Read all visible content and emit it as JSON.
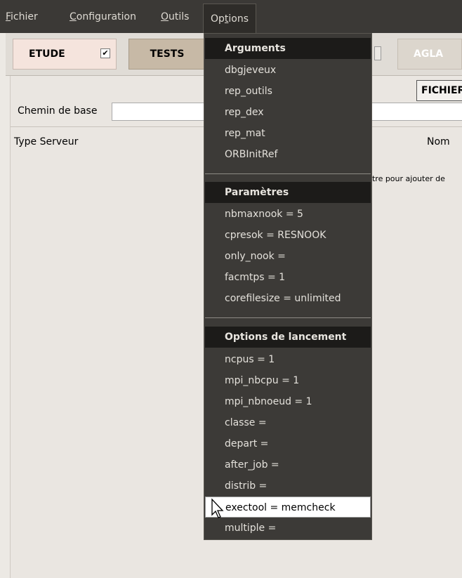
{
  "menubar": {
    "items": [
      {
        "label": "Fichier",
        "underline": "F",
        "rest": "ichier"
      },
      {
        "label": "Configuration",
        "underline": "C",
        "rest": "onfiguration"
      },
      {
        "label": "Outils",
        "underline": "O",
        "rest": "utils"
      },
      {
        "label": "Options",
        "pre": "Op",
        "underline": "t",
        "rest": "ions"
      }
    ]
  },
  "toolbar": {
    "etude_label": "ETUDE",
    "etude_checked": "✔",
    "tests_label": "TESTS",
    "agla_label": "AGLA"
  },
  "main": {
    "fichier_button": "FICHIER",
    "chemin_label": "Chemin de base",
    "chemin_value": "",
    "type_serveur_label": "Type Serveur",
    "nom_label": "Nom",
    "hint_text": "ntre pour ajouter de"
  },
  "options_menu": {
    "sections": [
      {
        "header": "Arguments",
        "items": [
          "dbgjeveux",
          "rep_outils",
          "rep_dex",
          "rep_mat",
          "ORBInitRef"
        ]
      },
      {
        "header": "Paramètres",
        "items": [
          "nbmaxnook = 5",
          "cpresok = RESNOOK",
          "only_nook =",
          "facmtps = 1",
          "corefilesize = unlimited"
        ]
      },
      {
        "header": "Options de lancement",
        "items": [
          "ncpus = 1",
          "mpi_nbcpu = 1",
          "mpi_nbnoeud = 1",
          "classe =",
          "depart =",
          "after_job =",
          "distrib =",
          "exectool = memcheck",
          "multiple ="
        ],
        "highlighted": "exectool = memcheck"
      }
    ]
  },
  "colors": {
    "menubar_bg": "#3b3936",
    "menu_bg": "#3c3a37",
    "section_header_bg": "#1c1b19",
    "highlight_bg": "#ffffff",
    "etude_bg": "#f5e4dd",
    "tests_bg": "#c7b9a6"
  }
}
